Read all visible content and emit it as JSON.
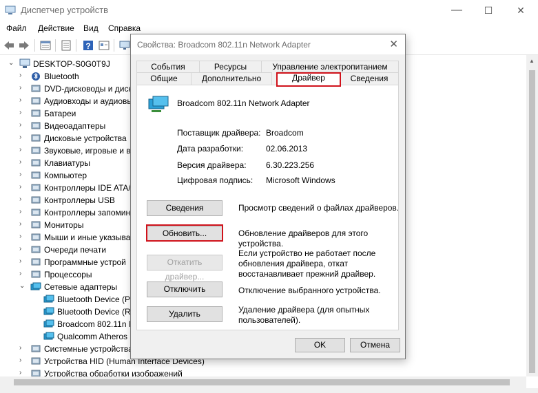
{
  "window": {
    "title": "Диспетчер устройств",
    "controls": {
      "minimize": "—",
      "maximize": "☐",
      "close": "✕"
    }
  },
  "menu": [
    "Файл",
    "Действие",
    "Вид",
    "Справка"
  ],
  "toolbar_icons": [
    "back-arrow-icon",
    "forward-arrow-icon",
    "properties-icon",
    "update-icon",
    "help-icon",
    "view-icon",
    "monitor-icon"
  ],
  "tree": {
    "root": "DESKTOP-S0G0T9J",
    "categories": [
      {
        "label": "Bluetooth",
        "icon": "bluetooth-icon"
      },
      {
        "label": "DVD-дисководы и диск",
        "icon": "dvd-icon"
      },
      {
        "label": "Аудиовходы и аудиовы",
        "icon": "audio-icon"
      },
      {
        "label": "Батареи",
        "icon": "battery-icon"
      },
      {
        "label": "Видеоадаптеры",
        "icon": "display-adapter-icon"
      },
      {
        "label": "Дисковые устройства",
        "icon": "disk-icon"
      },
      {
        "label": "Звуковые, игровые и в",
        "icon": "sound-icon"
      },
      {
        "label": "Клавиатуры",
        "icon": "keyboard-icon"
      },
      {
        "label": "Компьютер",
        "icon": "computer-icon"
      },
      {
        "label": "Контроллеры IDE ATA/",
        "icon": "ide-controller-icon"
      },
      {
        "label": "Контроллеры USB",
        "icon": "usb-icon"
      },
      {
        "label": "Контроллеры запомин",
        "icon": "storage-controller-icon"
      },
      {
        "label": "Мониторы",
        "icon": "monitor-icon"
      },
      {
        "label": "Мыши и иные указыва",
        "icon": "mouse-icon"
      },
      {
        "label": "Очереди печати",
        "icon": "printer-icon"
      },
      {
        "label": "Программные устрой",
        "icon": "software-device-icon"
      },
      {
        "label": "Процессоры",
        "icon": "processor-icon"
      },
      {
        "label": "Сетевые адаптеры",
        "icon": "network-adapter-icon",
        "expanded": true
      }
    ],
    "network_children": [
      "Bluetooth Device (Pe",
      "Bluetooth Device (RF",
      "Broadcom 802.11n N",
      "Qualcomm Atheros"
    ],
    "after": [
      {
        "label": "Системные устройства",
        "icon": "system-device-icon"
      },
      {
        "label": "Устройства HID (Human Interface Devices)",
        "icon": "hid-icon"
      },
      {
        "label": "Устройства обработки изображений",
        "icon": "camera-icon"
      }
    ]
  },
  "dialog": {
    "title": "Свойства: Broadcom 802.11n Network Adapter",
    "close": "✕",
    "tabs_row1": [
      "События",
      "Ресурсы",
      "Управление электропитанием"
    ],
    "tabs_row2": [
      "Общие",
      "Дополнительно",
      "Драйвер",
      "Сведения"
    ],
    "active_tab": "Драйвер",
    "device_name": "Broadcom 802.11n Network Adapter",
    "props": [
      {
        "key": "Поставщик драйвера:",
        "value": "Broadcom"
      },
      {
        "key": "Дата разработки:",
        "value": "02.06.2013"
      },
      {
        "key": "Версия драйвера:",
        "value": "6.30.223.256"
      },
      {
        "key": "Цифровая подпись:",
        "value": "Microsoft Windows"
      }
    ],
    "actions": [
      {
        "button": "Сведения",
        "desc": "Просмотр сведений о файлах драйверов.",
        "enabled": true
      },
      {
        "button": "Обновить...",
        "desc": "Обновление драйверов для этого устройства.",
        "enabled": true
      },
      {
        "button": "Откатить драйвер...",
        "desc": "Если устройство не работает после обновления драйвера, откат восстанавливает прежний драйвер.",
        "enabled": false
      },
      {
        "button": "Отключить",
        "desc": "Отключение выбранного устройства.",
        "enabled": true
      },
      {
        "button": "Удалить",
        "desc": "Удаление драйвера (для опытных пользователей).",
        "enabled": true
      }
    ],
    "ok": "OK",
    "cancel": "Отмена"
  },
  "colors": {
    "highlight_red": "#d0121b",
    "dialog_bg": "#f0f0f0",
    "button_bg": "#e1e1e1"
  }
}
